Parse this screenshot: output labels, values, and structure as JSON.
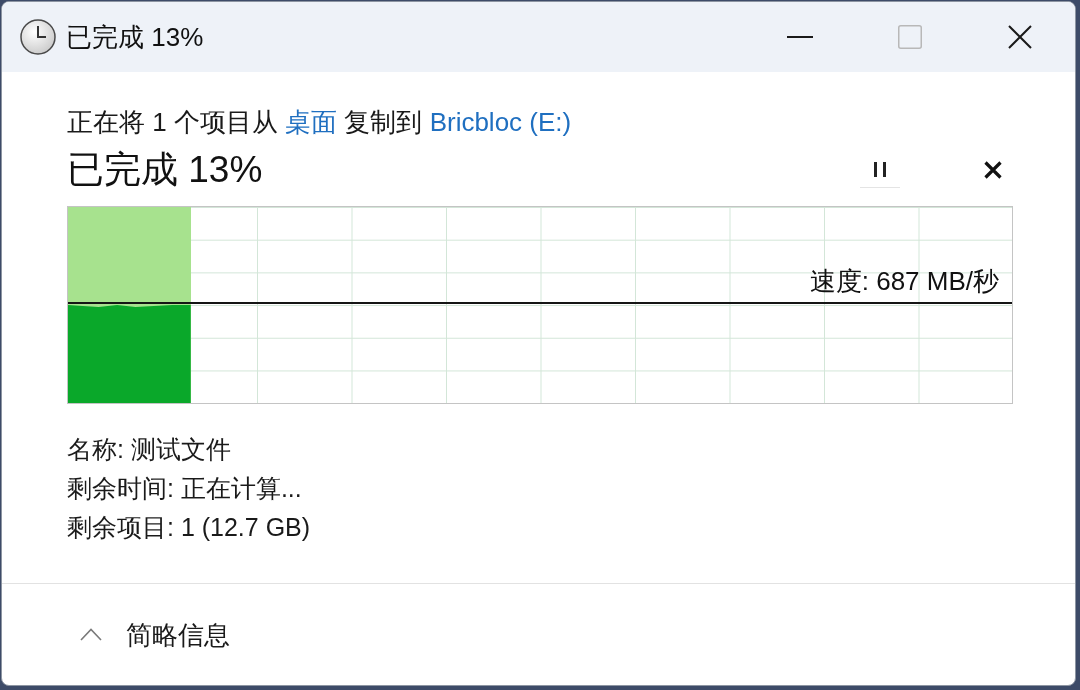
{
  "window": {
    "title": "已完成 13%",
    "controls": [
      {
        "kind": "minimize",
        "disabled": false
      },
      {
        "kind": "maximize",
        "disabled": true
      },
      {
        "kind": "close",
        "disabled": false
      }
    ]
  },
  "copy_status": [
    {
      "kind": "text",
      "text": "正在将 1 个项目从"
    },
    {
      "kind": "link",
      "text": "桌面"
    },
    {
      "kind": "text",
      "text": "复制到"
    },
    {
      "kind": "link",
      "text": "Bricbloc (E:)"
    }
  ],
  "progress": {
    "title": "已完成 13%",
    "level": 0.13,
    "speed": "速度: 687 MB/秒",
    "actions": [
      {
        "kind": "pause"
      },
      {
        "kind": "cancel"
      }
    ]
  },
  "details": [
    "名称: 测试文件",
    "剩余时间: 正在计算...",
    "剩余项目: 1 (12.7 GB)"
  ],
  "footer": {
    "toggle": {
      "label": "简略信息",
      "expanded": true
    }
  }
}
